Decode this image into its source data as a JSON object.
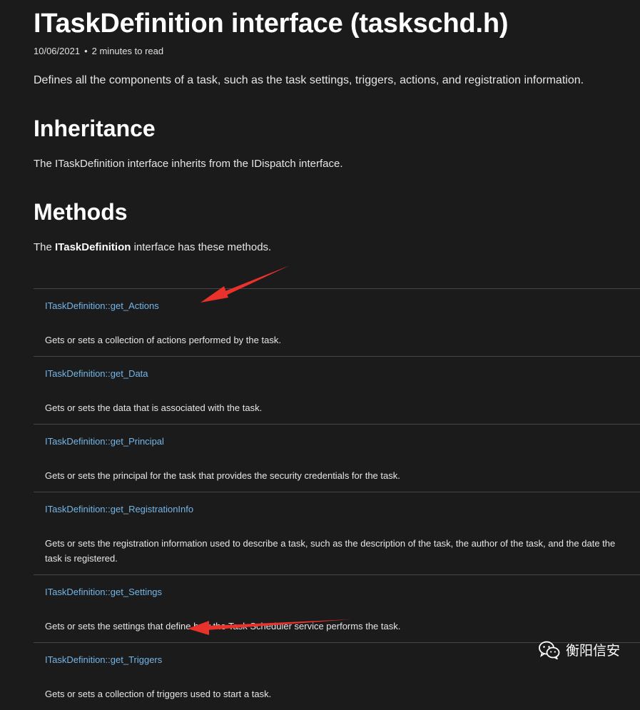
{
  "doc": {
    "title": "ITaskDefinition interface (taskschd.h)",
    "date": "10/06/2021",
    "dot": "•",
    "read_time": "2 minutes to read",
    "description": "Defines all the components of a task, such as the task settings, triggers, actions, and registration information."
  },
  "inheritance": {
    "heading": "Inheritance",
    "text": "The ITaskDefinition interface inherits from the IDispatch interface."
  },
  "methods": {
    "heading": "Methods",
    "text_prefix": "The ",
    "text_bold": "ITaskDefinition",
    "text_suffix": " interface has these methods.",
    "rows": [
      {
        "name": "ITaskDefinition::get_Actions",
        "desc": "Gets or sets a collection of actions performed by the task."
      },
      {
        "name": "ITaskDefinition::get_Data",
        "desc": "Gets or sets the data that is associated with the task."
      },
      {
        "name": "ITaskDefinition::get_Principal",
        "desc": "Gets or sets the principal for the task that provides the security credentials for the task."
      },
      {
        "name": "ITaskDefinition::get_RegistrationInfo",
        "desc": "Gets or sets the registration information used to describe a task, such as the description of the task, the author of the task, and the date the task is registered."
      },
      {
        "name": "ITaskDefinition::get_Settings",
        "desc": "Gets or sets the settings that define how the Task Scheduler service performs the task."
      },
      {
        "name": "ITaskDefinition::get_Triggers",
        "desc": "Gets or sets a collection of triggers used to start a task."
      }
    ]
  },
  "annotations": {
    "arrow_color": "#e8322b"
  },
  "watermark": {
    "text": "衡阳信安",
    "icon": "wechat-icon"
  },
  "colors": {
    "background": "#1b1b1b",
    "link": "#75b6e7",
    "divider": "#454545"
  }
}
